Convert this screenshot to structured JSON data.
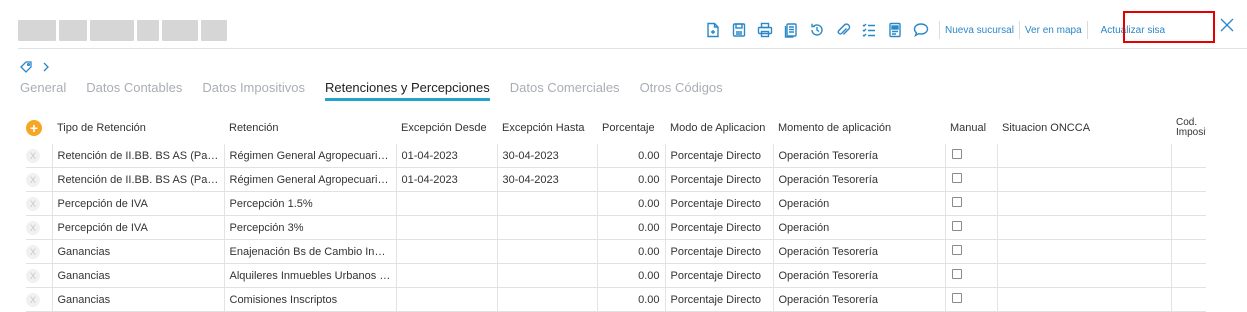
{
  "toolbar": {
    "icons": [
      "new-document-icon",
      "save-icon",
      "print-icon",
      "copy-icon",
      "history-icon",
      "attachment-icon",
      "checklist-icon",
      "notes-icon",
      "comment-icon"
    ],
    "links": {
      "nueva_sucursal": "Nueva sucursal",
      "ver_en_mapa": "Ver en mapa",
      "actualizar_sisa": "Actualizar sisa"
    },
    "highlight_color": "#e30000"
  },
  "tabs": [
    {
      "label": "General",
      "active": false
    },
    {
      "label": "Datos Contables",
      "active": false
    },
    {
      "label": "Datos Impositivos",
      "active": false
    },
    {
      "label": "Retenciones y Percepciones",
      "active": true
    },
    {
      "label": "Datos Comerciales",
      "active": false
    },
    {
      "label": "Otros Códigos",
      "active": false
    }
  ],
  "table": {
    "headers": [
      "Tipo de Retención",
      "Retención",
      "Excepción Desde",
      "Excepción Hasta",
      "Porcentaje",
      "Modo de Aplicacion",
      "Momento de aplicación",
      "Manual",
      "Situacion ONCCA",
      "Cod. Imposit"
    ],
    "rows": [
      [
        "Retención de II.BB. BS AS (Padrón)",
        "Régimen General Agropecuario Inscriptos",
        "01-04-2023",
        "30-04-2023",
        "0.00",
        "Porcentaje Directo",
        "Operación Tesorería",
        "",
        ""
      ],
      [
        "Retención de II.BB. BS AS (Padrón)",
        "Régimen General Agropecuario Inscriptos",
        "01-04-2023",
        "30-04-2023",
        "0.00",
        "Porcentaje Directo",
        "Operación Tesorería",
        "",
        ""
      ],
      [
        "Percepción de IVA",
        "Percepción 1.5%",
        "",
        "",
        "0.00",
        "Porcentaje Directo",
        "Operación",
        "",
        ""
      ],
      [
        "Percepción de IVA",
        "Percepción 3%",
        "",
        "",
        "0.00",
        "Porcentaje Directo",
        "Operación",
        "",
        ""
      ],
      [
        "Ganancias",
        "Enajenación Bs de Cambio Inscriptos",
        "",
        "",
        "0.00",
        "Porcentaje Directo",
        "Operación Tesorería",
        "",
        ""
      ],
      [
        "Ganancias",
        "Alquileres Inmuebles Urbanos Inscriptos",
        "",
        "",
        "0.00",
        "Porcentaje Directo",
        "Operación Tesorería",
        "",
        ""
      ],
      [
        "Ganancias",
        "Comisiones Inscriptos",
        "",
        "",
        "0.00",
        "Porcentaje Directo",
        "Operación Tesorería",
        "",
        ""
      ]
    ],
    "delete_symbol": "X",
    "add_symbol": "+"
  },
  "colors": {
    "accent": "#2b88c8",
    "tab_underline": "#23a3c9",
    "add_button": "#f5a623"
  }
}
